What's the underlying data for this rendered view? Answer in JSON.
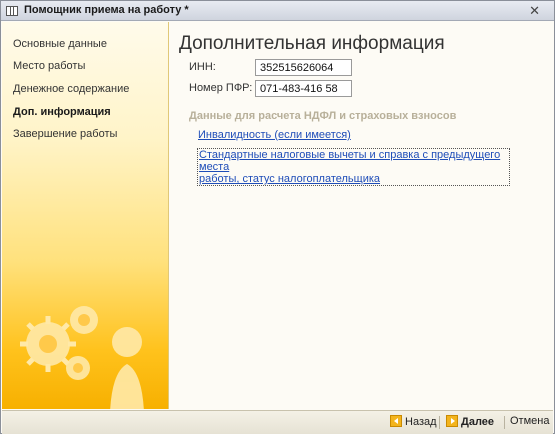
{
  "window": {
    "title": "Помощник приема на работу *",
    "close_glyph": "✕"
  },
  "sidebar": {
    "items": [
      {
        "label": "Основные данные"
      },
      {
        "label": "Место работы"
      },
      {
        "label": "Денежное содержание"
      },
      {
        "label": "Доп. информация",
        "active": true
      },
      {
        "label": "Завершение работы"
      }
    ]
  },
  "main": {
    "title": "Дополнительная информация",
    "inn": {
      "label": "ИНН:",
      "value": "352515626064"
    },
    "pfr": {
      "label": "Номер ПФР:",
      "value": "071-483-416 58"
    },
    "section_title": "Данные для расчета НДФЛ и страховых взносов",
    "links": {
      "disability": "Инвалидность (если имеется)",
      "deductions_line1": "Стандартные налоговые вычеты и справка с предыдущего места",
      "deductions_line2": "работы, статус налогоплательщика"
    }
  },
  "footer": {
    "back": "Назад",
    "next": "Далее",
    "cancel": "Отмена"
  },
  "colors": {
    "accent": "#f3b41c",
    "link": "#1f4db8",
    "section": "#b8b09a"
  }
}
